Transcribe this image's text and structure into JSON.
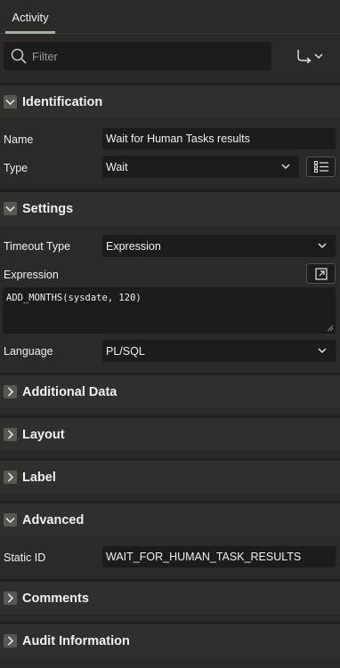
{
  "tabs": [
    {
      "label": "Activity",
      "active": true
    }
  ],
  "filter": {
    "placeholder": "Filter",
    "value": ""
  },
  "sections": {
    "identification": {
      "title": "Identification",
      "expanded": true
    },
    "settings": {
      "title": "Settings",
      "expanded": true
    },
    "additional_data": {
      "title": "Additional Data",
      "expanded": false
    },
    "layout": {
      "title": "Layout",
      "expanded": false
    },
    "label": {
      "title": "Label",
      "expanded": false
    },
    "advanced": {
      "title": "Advanced",
      "expanded": true
    },
    "comments": {
      "title": "Comments",
      "expanded": false
    },
    "audit": {
      "title": "Audit Information",
      "expanded": false
    }
  },
  "identification": {
    "name_label": "Name",
    "name_value": "Wait for Human Tasks results",
    "type_label": "Type",
    "type_value": "Wait"
  },
  "settings": {
    "timeout_type_label": "Timeout Type",
    "timeout_type_value": "Expression",
    "expression_label": "Expression",
    "expression_value": "ADD_MONTHS(sysdate, 120)",
    "language_label": "Language",
    "language_value": "PL/SQL"
  },
  "advanced": {
    "static_id_label": "Static ID",
    "static_id_value": "WAIT_FOR_HUMAN_TASK_RESULTS"
  },
  "colors": {
    "background": "#2b2a28",
    "section_header": "#312f2d",
    "field": "#1d1c1b",
    "tab_accent": "#9fb59d"
  }
}
